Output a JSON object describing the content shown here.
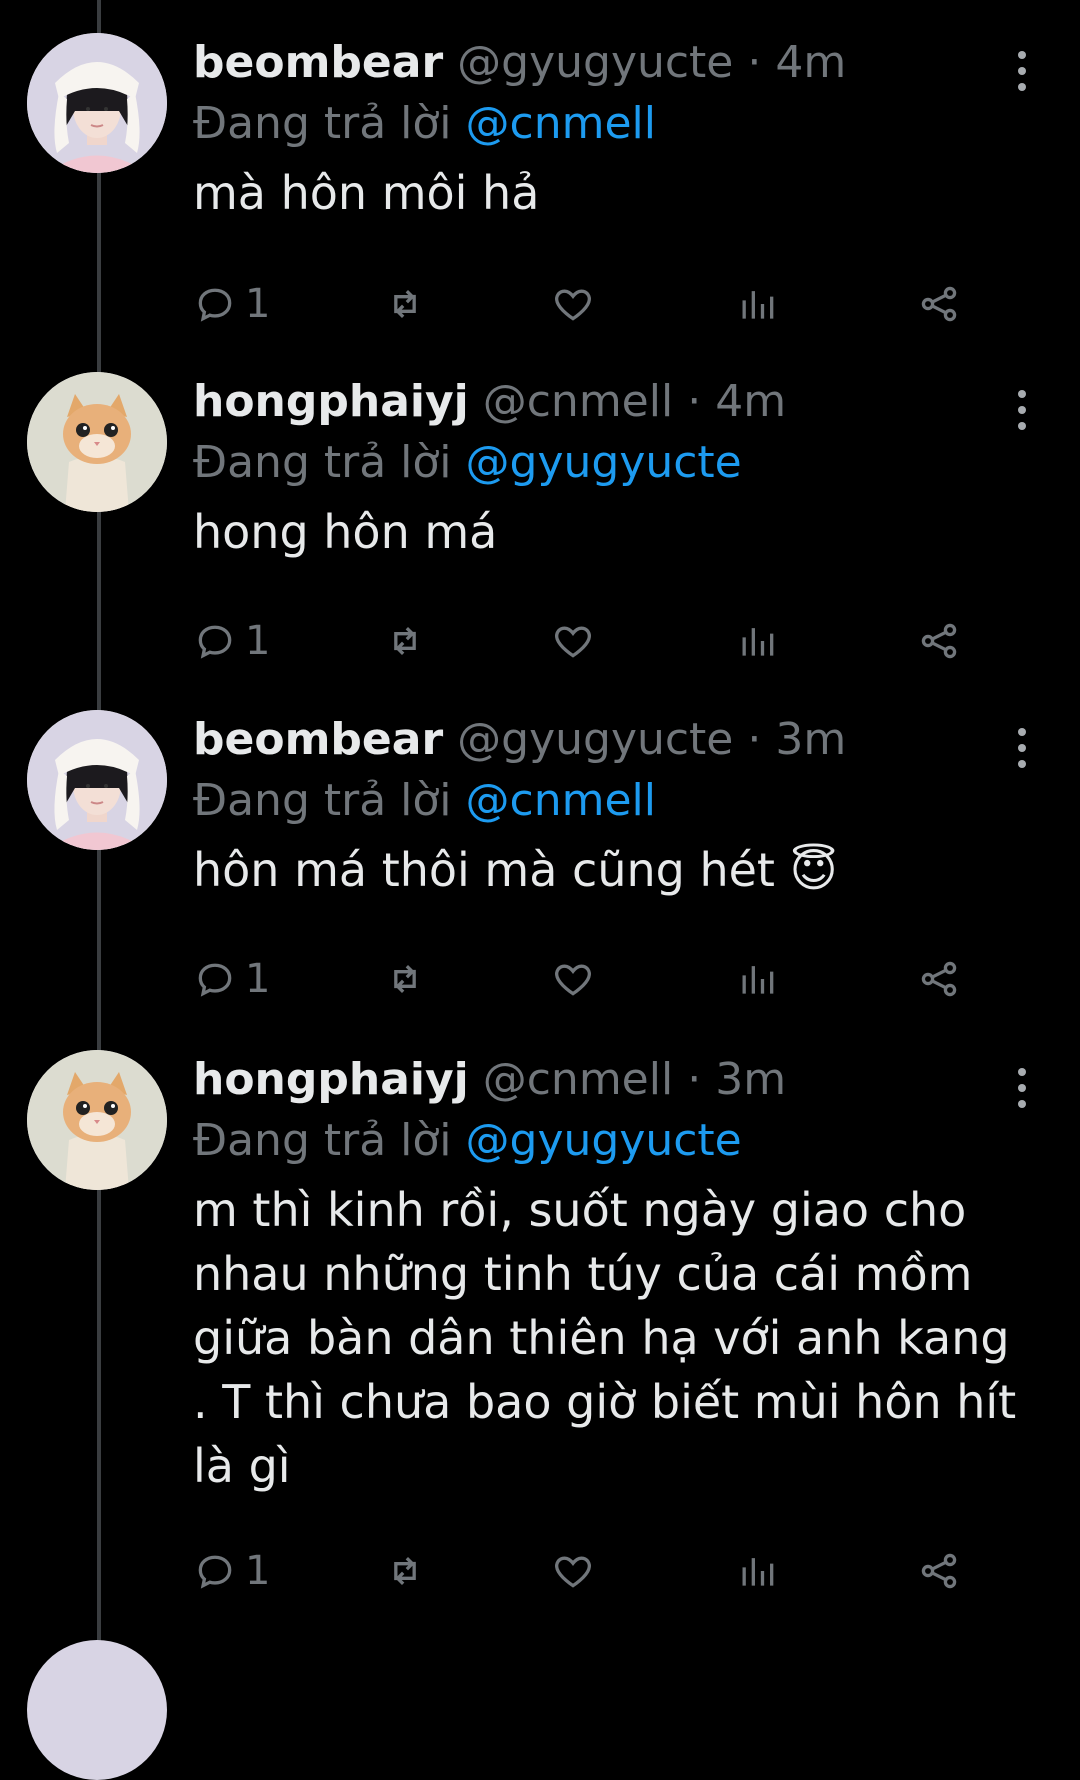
{
  "tweets": [
    {
      "name": "beombear",
      "handle": "@gyugyucte",
      "time": "4m",
      "reply_prefix": "Đang trả lời",
      "reply_to": "@cnmell",
      "text": "mà hôn môi hả",
      "reply_count": "1",
      "avatar": "girl-bunny-hat-avatar"
    },
    {
      "name": "hongphaiyj",
      "handle": "@cnmell",
      "time": "4m",
      "reply_prefix": "Đang trả lời",
      "reply_to": "@gyugyucte",
      "text": "hong hôn má",
      "reply_count": "1",
      "avatar": "orange-cat-avatar"
    },
    {
      "name": "beombear",
      "handle": "@gyugyucte",
      "time": "3m",
      "reply_prefix": "Đang trả lời",
      "reply_to": "@cnmell",
      "text": "hôn má thôi mà cũng hét 😇",
      "reply_count": "1",
      "avatar": "girl-bunny-hat-avatar"
    },
    {
      "name": "hongphaiyj",
      "handle": "@cnmell",
      "time": "3m",
      "reply_prefix": "Đang trả lời",
      "reply_to": "@gyugyucte",
      "text": "m thì kinh rồi, suốt ngày giao cho nhau những tinh túy của cái mồm giữa bàn dân thiên hạ với anh kang . T thì chưa bao giờ biết mùi hôn hít là gì",
      "reply_count": "1",
      "avatar": "orange-cat-avatar"
    }
  ],
  "colors": {
    "background": "#000000",
    "text": "#e7e9ea",
    "muted": "#71767b",
    "mention": "#1d9bf0",
    "thread_line": "#3a3d40"
  }
}
